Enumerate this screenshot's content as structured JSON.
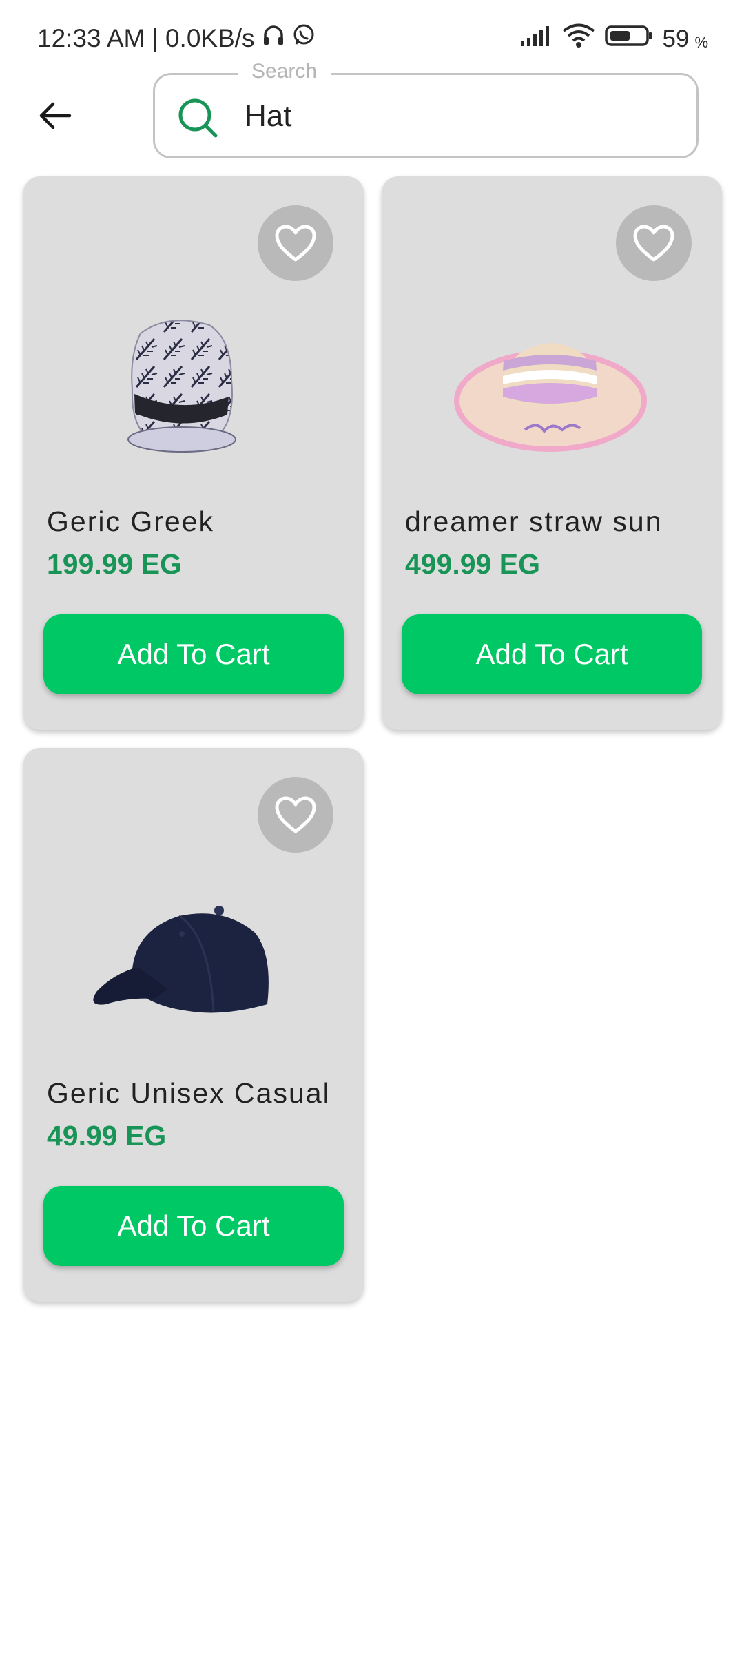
{
  "status_bar": {
    "time": "12:33 AM",
    "separator": "|",
    "net_speed": "0.0KB/s",
    "battery_level": "59",
    "battery_unit": "%",
    "icons": [
      "headphones-icon",
      "whatsapp-icon",
      "signal-icon",
      "wifi-icon",
      "battery-icon"
    ]
  },
  "search": {
    "legend": "Search",
    "value": "Hat",
    "placeholder": "Search"
  },
  "colors": {
    "accent": "#00c864",
    "price": "#189556",
    "card": "#dddddd",
    "fav_bg": "#b9b9b9"
  },
  "products": [
    {
      "name": "Geric Greek",
      "price": "199.99 EG",
      "cart_label": "Add To Cart",
      "favorite": false,
      "image": "fedora-hat"
    },
    {
      "name": "dreamer straw sun",
      "price": "499.99 EG",
      "cart_label": "Add To Cart",
      "favorite": false,
      "image": "straw-sun-hat"
    },
    {
      "name": "Geric Unisex Casual",
      "price": "49.99 EG",
      "cart_label": "Add To Cart",
      "favorite": false,
      "image": "baseball-cap"
    }
  ]
}
